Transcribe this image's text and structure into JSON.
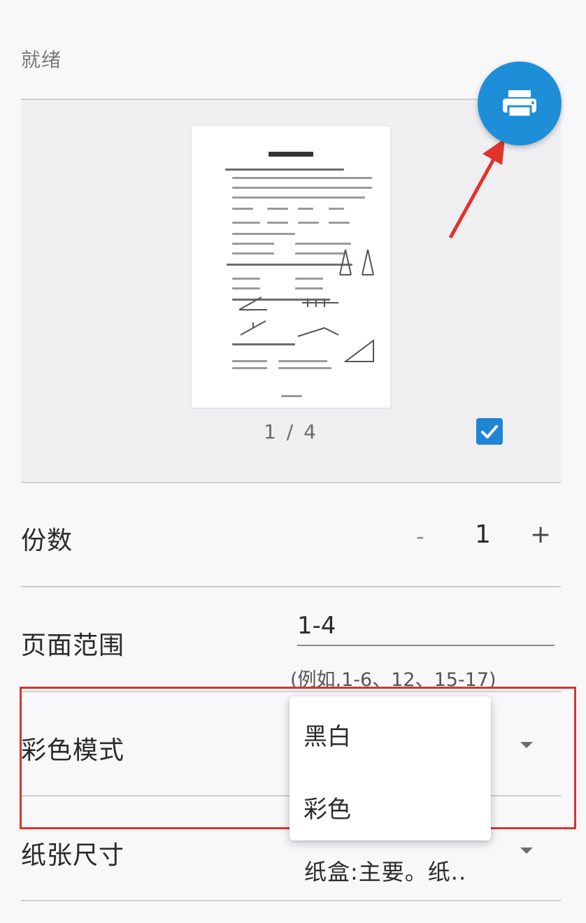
{
  "status": {
    "text": "就绪"
  },
  "preview": {
    "page_indicator": "1 / 4",
    "page_selected": true
  },
  "copies": {
    "label": "份数",
    "minus": "-",
    "value": "1",
    "plus": "+"
  },
  "page_range": {
    "label": "页面范围",
    "value": "1-4",
    "hint": "(例如,1-6、12、15-17)"
  },
  "color_mode": {
    "label": "彩色模式",
    "options": [
      "黑白",
      "彩色"
    ]
  },
  "paper_size": {
    "label": "纸张尺寸",
    "value": "纸盒:主要。纸.."
  },
  "colors": {
    "accent": "#1e8ed8",
    "highlight": "#d8332f",
    "arrow": "#e0332a"
  }
}
